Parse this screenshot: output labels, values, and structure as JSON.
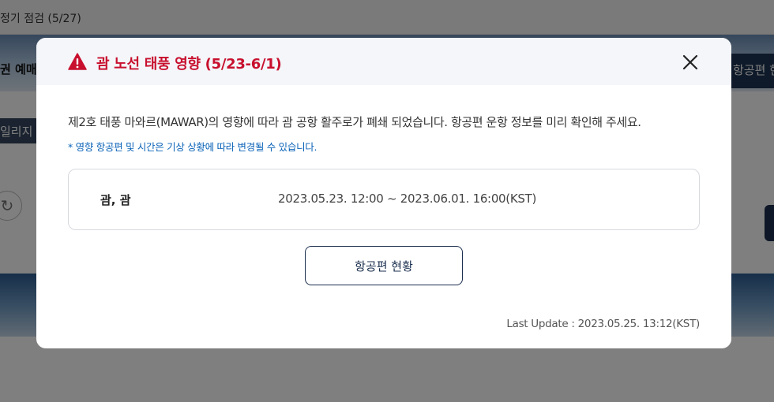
{
  "background": {
    "topbar_text": "정기 점검 (5/27)",
    "hero_left_text": "권 예매",
    "hero_right_button": "항공편 현",
    "tab_label": "일리지",
    "refresh_icon": "refresh-icon"
  },
  "modal": {
    "icon": "warning-icon",
    "title": "괌 노선 태풍 영향 (5/23-6/1)",
    "close_icon": "close-icon",
    "description": "제2호 태풍 마와르(MAWAR)의 영향에 따라 괌 공항 활주로가 폐쇄 되었습니다. 항공편 운항 정보를 미리 확인해 주세요.",
    "note": "* 영향 항공편 및 시간은 기상 상황에 따라 변경될 수 있습니다.",
    "info": {
      "location": "괌, 괌",
      "period": "2023.05.23. 12:00 ~ 2023.06.01. 16:00(KST)"
    },
    "flight_button": "항공편 현황",
    "last_update": "Last Update : 2023.05.25. 13:12(KST)"
  },
  "colors": {
    "title_red": "#c8102e",
    "note_blue": "#0b63b8",
    "button_navy": "#1b2f4e"
  }
}
